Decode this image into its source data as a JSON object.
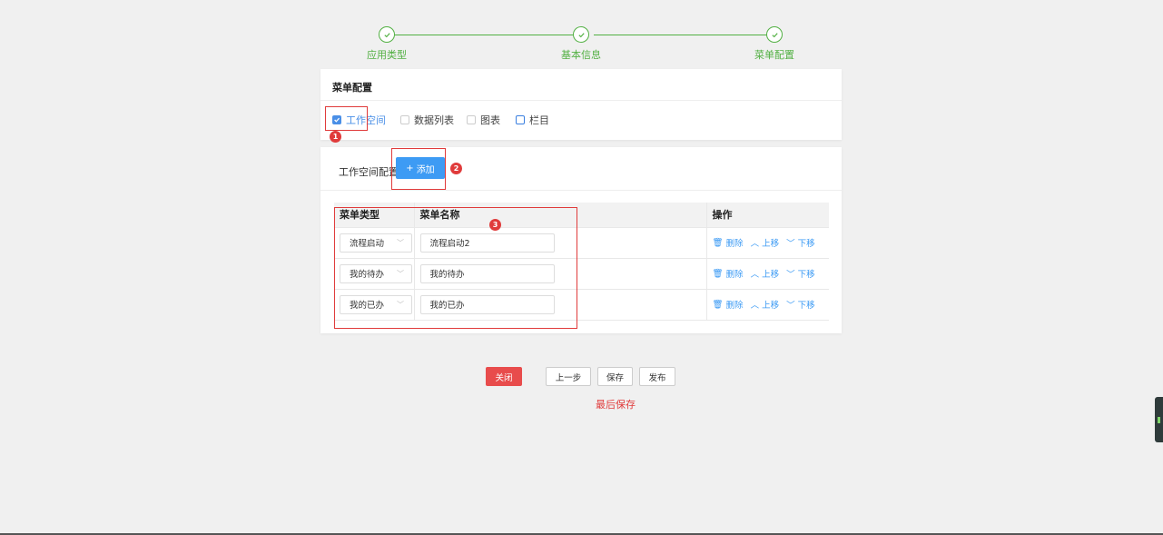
{
  "steps": [
    "应用类型",
    "基本信息",
    "菜单配置"
  ],
  "menu_panel": {
    "title": "菜单配置",
    "options": [
      {
        "label": "工作空间",
        "checked": true
      },
      {
        "label": "数据列表",
        "checked": false
      },
      {
        "label": "图表",
        "checked": false
      },
      {
        "label": "栏目",
        "checked": false
      }
    ]
  },
  "workspace_panel": {
    "title": "工作空间配置",
    "add_label": "添加",
    "columns": [
      "菜单类型",
      "菜单名称",
      "",
      "操作"
    ],
    "rows": [
      {
        "type": "流程启动",
        "name": "流程启动2"
      },
      {
        "type": "我的待办",
        "name": "我的待办"
      },
      {
        "type": "我的已办",
        "name": "我的已办"
      }
    ],
    "ops": {
      "delete": "删除",
      "up": "上移",
      "down": "下移"
    }
  },
  "annotations": [
    "1",
    "2",
    "3"
  ],
  "footer": {
    "close": "关闭",
    "prev": "上一步",
    "save": "保存",
    "publish": "发布",
    "note": "最后保存"
  },
  "colors": {
    "step": "#52b043",
    "primary": "#3d9bf4",
    "danger": "#e84c4c",
    "annotation": "#e03b3b"
  }
}
